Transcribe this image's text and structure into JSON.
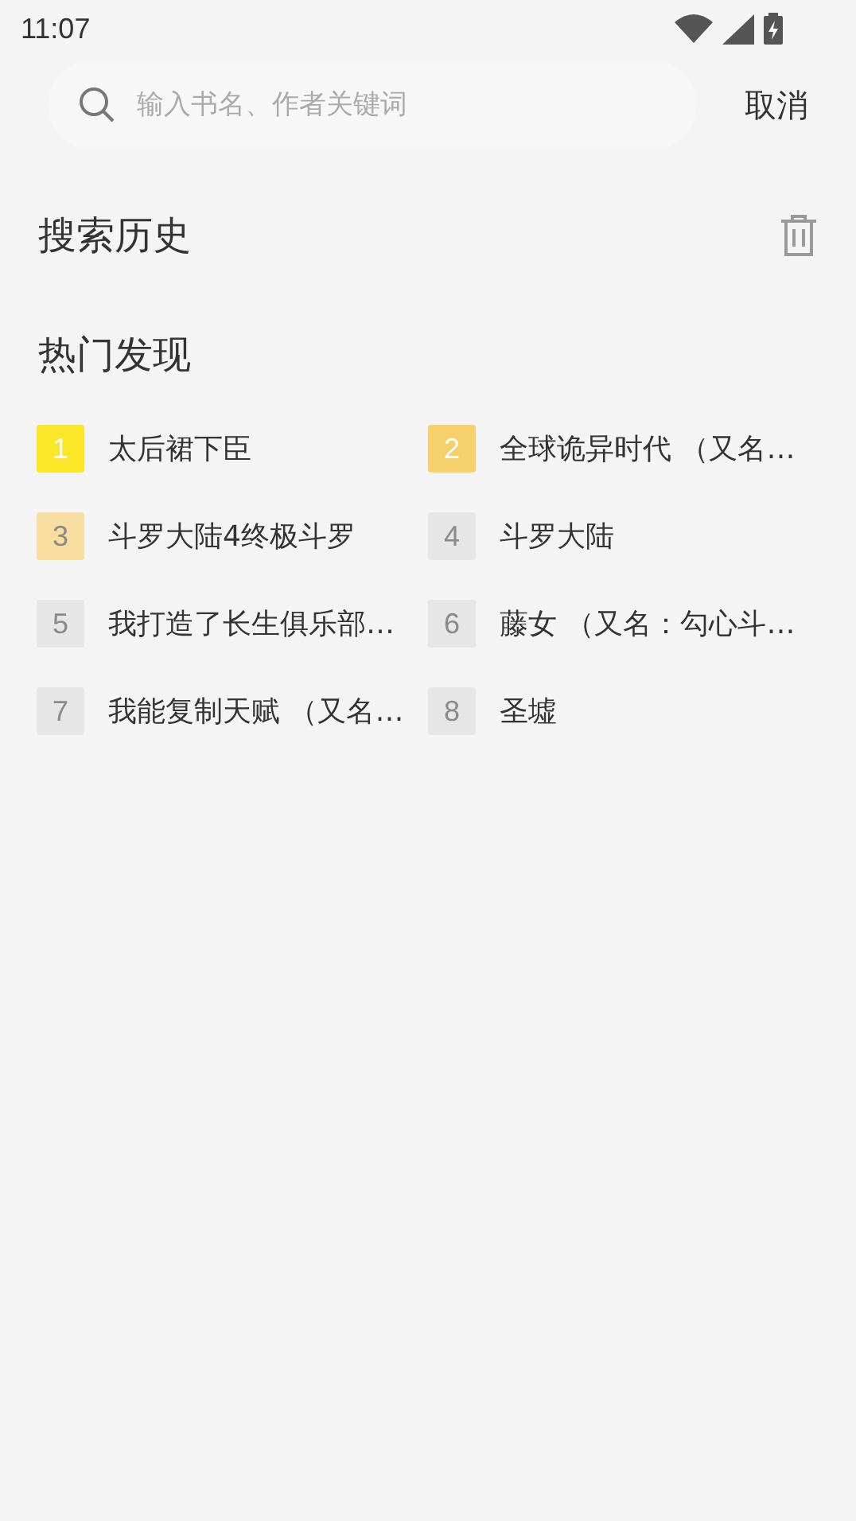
{
  "status_bar": {
    "time": "11:07"
  },
  "search": {
    "placeholder": "输入书名、作者关键词",
    "cancel": "取消"
  },
  "history": {
    "title": "搜索历史"
  },
  "hot": {
    "title": "热门发现",
    "items": [
      {
        "rank": "1",
        "title": "太后裙下臣",
        "color": "#fbe727"
      },
      {
        "rank": "2",
        "title": "全球诡异时代 （又名…",
        "color": "#f6d06b"
      },
      {
        "rank": "3",
        "title": "斗罗大陆4终极斗罗",
        "color": "#f8dea0"
      },
      {
        "rank": "4",
        "title": "斗罗大陆",
        "color": "#e6e6e6"
      },
      {
        "rank": "5",
        "title": "我打造了长生俱乐部…",
        "color": "#e6e6e6"
      },
      {
        "rank": "6",
        "title": "藤女 （又名：勾心斗…",
        "color": "#e6e6e6"
      },
      {
        "rank": "7",
        "title": "我能复制天赋 （又名…",
        "color": "#e6e6e6"
      },
      {
        "rank": "8",
        "title": "圣墟",
        "color": "#e6e6e6"
      }
    ]
  }
}
